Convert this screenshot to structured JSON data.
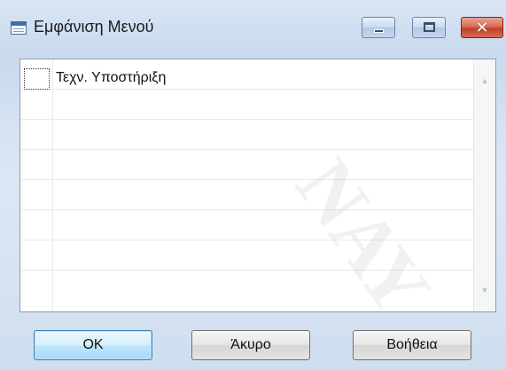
{
  "window": {
    "title": "Εμφάνιση Μενού",
    "title_icon": "table-window-icon",
    "controls": {
      "minimize_icon": "minimize-icon",
      "maximize_icon": "maximize-icon",
      "close_icon": "close-icon",
      "close_glyph": "✕"
    }
  },
  "list": {
    "items": [
      {
        "label": "Τεχν. Υποστήριξη",
        "focused": true
      }
    ],
    "empty_rows": 7,
    "scroll_up_icon": "scroll-up-arrow-icon",
    "scroll_down_icon": "scroll-down-arrow-icon"
  },
  "buttons": {
    "ok_label": "OK",
    "cancel_label": "Άκυρο",
    "help_label": "Βοήθεια"
  },
  "watermark": {
    "text": "ΝΑΥ"
  },
  "colors": {
    "window_gradient_top": "#d9e5f3",
    "window_gradient_bottom": "#cfdeef",
    "close_button_red": "#c2402a",
    "default_button_blue": "#3c7fb1"
  }
}
